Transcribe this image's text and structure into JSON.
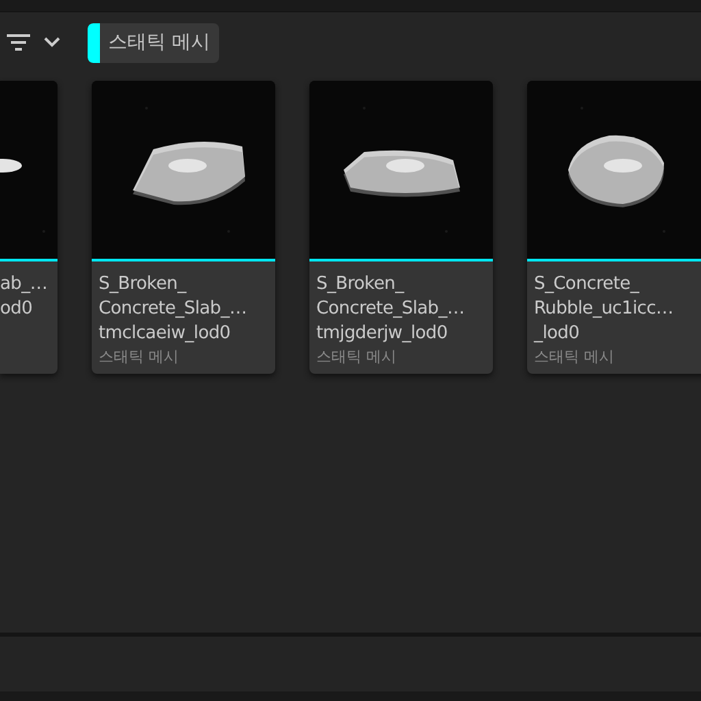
{
  "toolbar": {
    "filter_chip": {
      "label": "스태틱 메시",
      "color": "#00ffff"
    }
  },
  "assets": [
    {
      "kind": "partial",
      "title_lines": [
        "ab_…",
        "od0"
      ]
    },
    {
      "kind": "full",
      "title_lines": [
        "S_Broken_",
        "Concrete_Slab_…",
        "tmclcaeiw_lod0"
      ],
      "type": "스태틱 메시"
    },
    {
      "kind": "full",
      "title_lines": [
        "S_Broken_",
        "Concrete_Slab_…",
        "tmjgderjw_lod0"
      ],
      "type": "스태틱 메시"
    },
    {
      "kind": "full",
      "title_lines": [
        "S_Concrete_",
        "Rubble_uc1icc…",
        "_lod0"
      ],
      "type": "스태틱 메시"
    }
  ]
}
